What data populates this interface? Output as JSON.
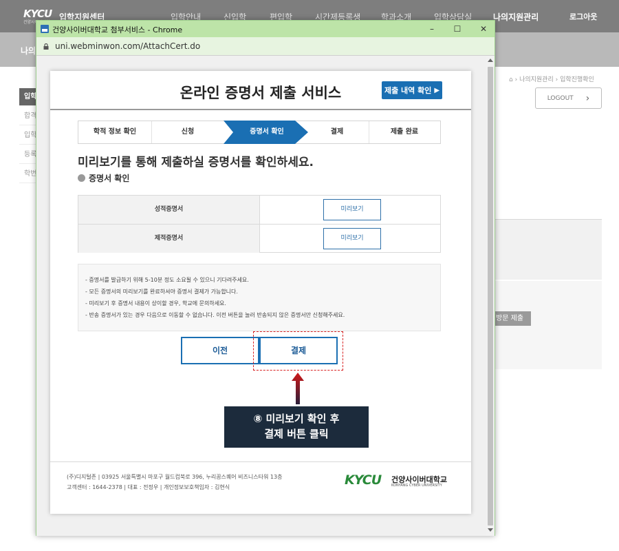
{
  "site": {
    "logo": "KYCU",
    "logo_sub": "건양사이버대학교",
    "title": "입학지원센터",
    "nav": [
      "입학안내",
      "신입학",
      "편입학",
      "시간제등록생",
      "학과소개",
      "입학상담실",
      "나의지원관리"
    ],
    "logout": "로그아웃",
    "band_text": "나의",
    "side_items": [
      "입학",
      "합격",
      "입학",
      "등록",
      "학번"
    ],
    "breadcrumb": [
      "나의지원관리",
      "입학진행확인"
    ],
    "logout_button": "LOGOUT",
    "gray_button": "방문 제출"
  },
  "popup": {
    "window_title": "건양사이버대학교 첨부서비스 - Chrome",
    "url": "uni.webminwon.com/AttachCert.do",
    "card": {
      "title": "온라인 증명서 제출 서비스",
      "history_button": "제출 내역 확인",
      "steps": [
        "학적 정보 확인",
        "신청",
        "증명서 확인",
        "결제",
        "제출 완료"
      ],
      "active_step": 2,
      "heading": "미리보기를 통해 제출하실 증명서를 확인하세요.",
      "sub_heading": "증명서 확인",
      "documents": [
        {
          "label": "성적증명서",
          "button": "미리보기"
        },
        {
          "label": "제적증명서",
          "button": "미리보기"
        }
      ],
      "notices": [
        "- 증명서를 발급하기 위해 5-10분 정도 소요될 수 있으니 기다려주세요.",
        "- 모든 증명서의 미리보기를 완료하셔야 증명서 결제가 가능합니다.",
        "- 미리보기 후 증명서 내용이 상이할 경우, 학교에 문의하세요.",
        "- 반송 증명서가 있는 경우 다음으로 이동할 수 없습니다. 이전 버튼을 눌러 반송되지 않은 증명서만 신청해주세요."
      ],
      "prev_button": "이전",
      "pay_button": "결제",
      "footer": {
        "line1": "(주)디지털존 | 03925 서울특별시 마포구 월드컵북로 396, 누리꿈스퀘어 비즈니스타워 13층",
        "line2": "고객센터 : 1644-2378 | 대표 : 전정우 | 개인정보보호책임자 : 김현식",
        "logo_main": "KYCU",
        "logo_kr": "건양사이버대학교",
        "logo_en": "KONYANG CYBER UNIVERSITY"
      }
    }
  },
  "annotation": {
    "line1": "⑧ 미리보기 확인 후",
    "line2": "결제 버튼 클릭",
    "arrow_color": "#c01818",
    "box_color": "#1c2b3c"
  },
  "colors": {
    "primary": "#1a6fb3",
    "titlebar": "#bde4a8",
    "highlight": "#d82020"
  }
}
